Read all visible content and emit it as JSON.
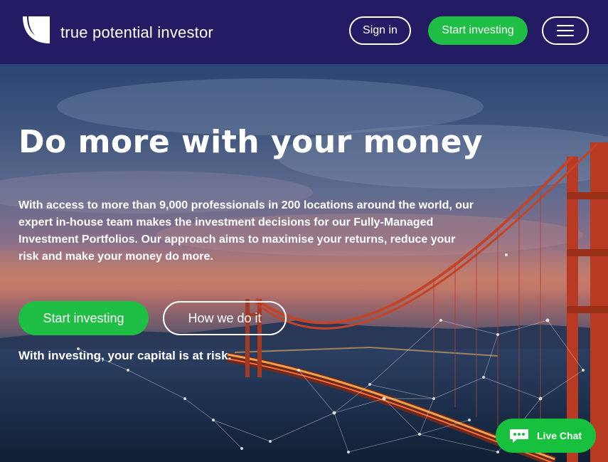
{
  "header": {
    "brand": "true potential investor",
    "signin_label": "Sign in",
    "start_label": "Start investing",
    "menu_icon": "hamburger-menu-icon"
  },
  "hero": {
    "title": "Do more with your money",
    "intro": "With access to more than 9,000 professionals in 200 locations around the world, our expert in-house team makes the investment decisions for our Fully-Managed Investment Portfolios. Our approach aims to maximise your returns, reduce your risk and make your money do more.",
    "start_label": "Start investing",
    "how_label": "How we do it",
    "risk_text": "With investing, your capital is at risk."
  },
  "chat": {
    "label": "Live Chat",
    "icon": "chat-bubble-icon"
  },
  "colors": {
    "header_bg": "#231b63",
    "accent_green": "#1fbe44",
    "bridge_red": "#b83a22"
  }
}
